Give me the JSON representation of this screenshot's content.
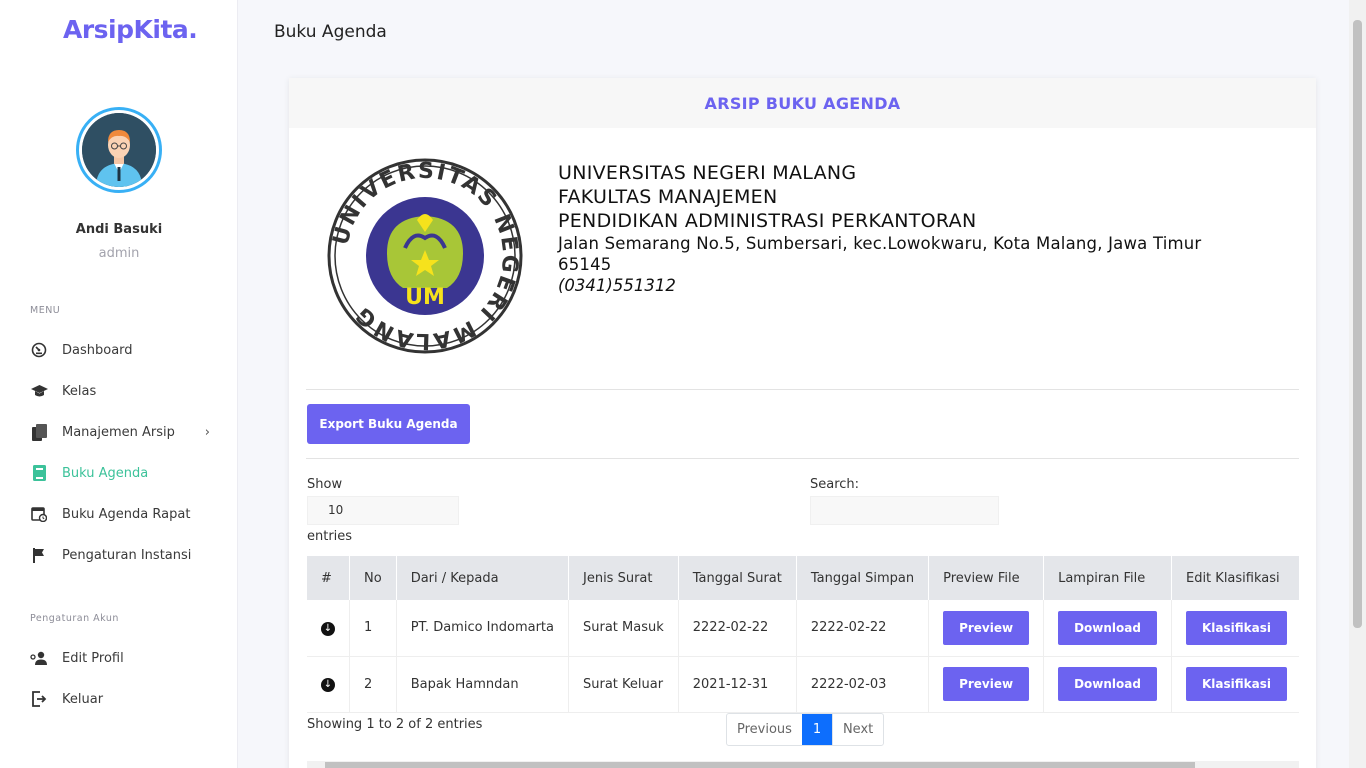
{
  "sidebar": {
    "brand": "ArsipKita.",
    "user_name": "Andi Basuki",
    "user_role": "admin",
    "menu_caption": "MENU",
    "items": [
      {
        "label": "Dashboard",
        "icon": "dashboard-icon"
      },
      {
        "label": "Kelas",
        "icon": "graduation-cap-icon"
      },
      {
        "label": "Manajemen Arsip",
        "icon": "copy-icon"
      },
      {
        "label": "Buku Agenda",
        "icon": "book-icon",
        "active": true
      },
      {
        "label": "Buku Agenda Rapat",
        "icon": "calendar-icon"
      },
      {
        "label": "Pengaturan Instansi",
        "icon": "flag-icon"
      }
    ],
    "account_caption": "Pengaturan Akun",
    "account_items": [
      {
        "label": "Edit Profil",
        "icon": "user-cog-icon"
      },
      {
        "label": "Keluar",
        "icon": "logout-icon"
      }
    ]
  },
  "header": {
    "title": "Buku Agenda"
  },
  "card": {
    "title": "ARSIP BUKU AGENDA",
    "institution": {
      "line1": "UNIVERSITAS NEGERI MALANG",
      "line2": "FAKULTAS MANAJEMEN",
      "line3": "PENDIDIKAN ADMINISTRASI PERKANTORAN",
      "address": "Jalan Semarang No.5, Sumbersari, kec.Lowokwaru, Kota Malang, Jawa Timur 65145",
      "phone": "(0341)551312",
      "logo_text": "UNIVERSITAS NEGERI MALANG",
      "logo_mark": "UM"
    },
    "export_label": "Export Buku Agenda",
    "show_label": "Show",
    "show_value": "10",
    "entries_label": "entries",
    "search_label": "Search:",
    "table": {
      "headers": [
        "#",
        "No",
        "Dari / Kepada",
        "Jenis Surat",
        "Tanggal Surat",
        "Tanggal Simpan",
        "Preview File",
        "Lampiran File",
        "Edit Klasifikasi",
        ""
      ],
      "rows": [
        {
          "no": "1",
          "from": "PT. Damico Indomarta",
          "type": "Surat Masuk",
          "date": "2222-02-22",
          "saved": "2222-02-22",
          "preview": "Preview",
          "download": "Download",
          "classify": "Klasifikasi"
        },
        {
          "no": "2",
          "from": "Bapak Hamndan",
          "type": "Surat Keluar",
          "date": "2021-12-31",
          "saved": "2222-02-03",
          "preview": "Preview",
          "download": "Download",
          "classify": "Klasifikasi"
        }
      ]
    },
    "info": "Showing 1 to 2 of 2 entries",
    "pager": {
      "prev": "Previous",
      "current": "1",
      "next": "Next"
    }
  },
  "colors": {
    "accent": "#6c63f0",
    "active_nav": "#3cc29a",
    "pager_active": "#0d6efd"
  }
}
